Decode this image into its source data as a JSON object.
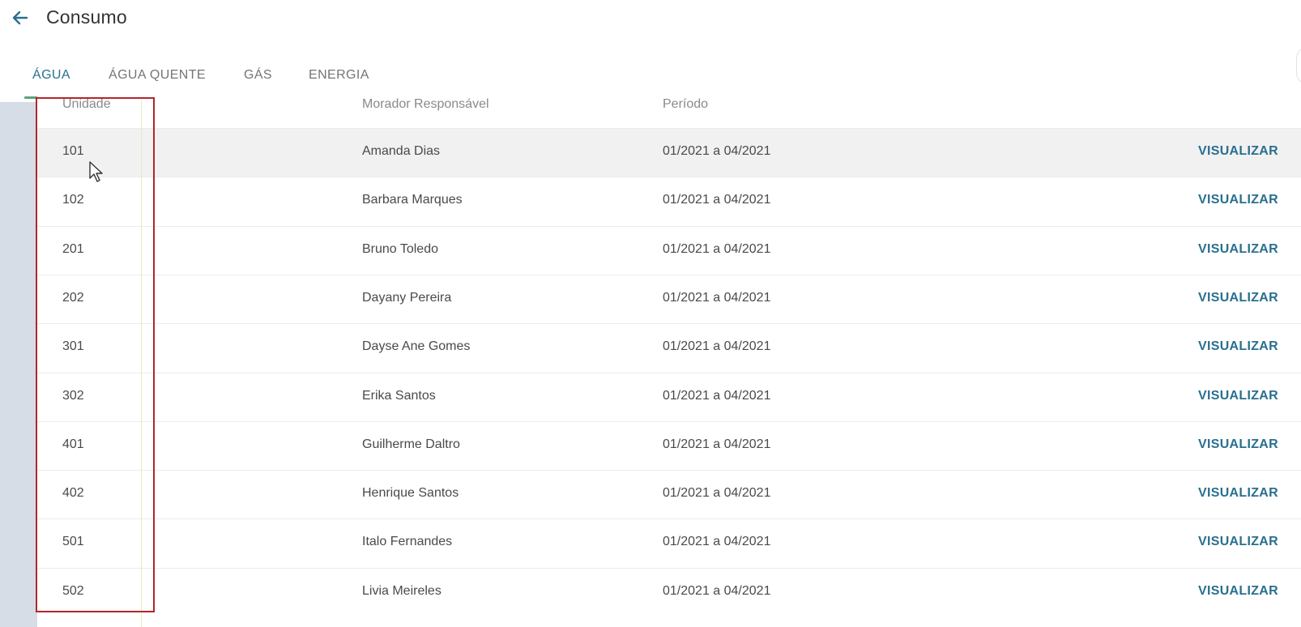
{
  "header": {
    "back_label": "←",
    "title": "Consumo"
  },
  "tabs": [
    {
      "label": "ÁGUA",
      "active": true
    },
    {
      "label": "ÁGUA QUENTE",
      "active": false
    },
    {
      "label": "GÁS",
      "active": false
    },
    {
      "label": "ENERGIA",
      "active": false
    }
  ],
  "table": {
    "columns": [
      "Unidade",
      "Morador Responsável",
      "Período"
    ],
    "action_label": "VISUALIZAR",
    "rows": [
      {
        "unit": "101",
        "resident": "Amanda Dias",
        "period": "01/2021 a 04/2021"
      },
      {
        "unit": "102",
        "resident": "Barbara Marques",
        "period": "01/2021 a 04/2021"
      },
      {
        "unit": "201",
        "resident": "Bruno Toledo",
        "period": "01/2021 a 04/2021"
      },
      {
        "unit": "202",
        "resident": "Dayany Pereira",
        "period": "01/2021 a 04/2021"
      },
      {
        "unit": "301",
        "resident": "Dayse Ane Gomes",
        "period": "01/2021 a 04/2021"
      },
      {
        "unit": "302",
        "resident": "Erika Santos",
        "period": "01/2021 a 04/2021"
      },
      {
        "unit": "401",
        "resident": "Guilherme Daltro",
        "period": "01/2021 a 04/2021"
      },
      {
        "unit": "402",
        "resident": "Henrique Santos",
        "period": "01/2021 a 04/2021"
      },
      {
        "unit": "501",
        "resident": "Italo Fernandes",
        "period": "01/2021 a 04/2021"
      },
      {
        "unit": "502",
        "resident": "Livia Meireles",
        "period": "01/2021 a 04/2021"
      }
    ]
  },
  "colors": {
    "accent": "#2a6f8f",
    "tab_indicator": "#5aa37a",
    "annotation_box": "#b3262a",
    "hover_row": "#f1f1f1"
  }
}
